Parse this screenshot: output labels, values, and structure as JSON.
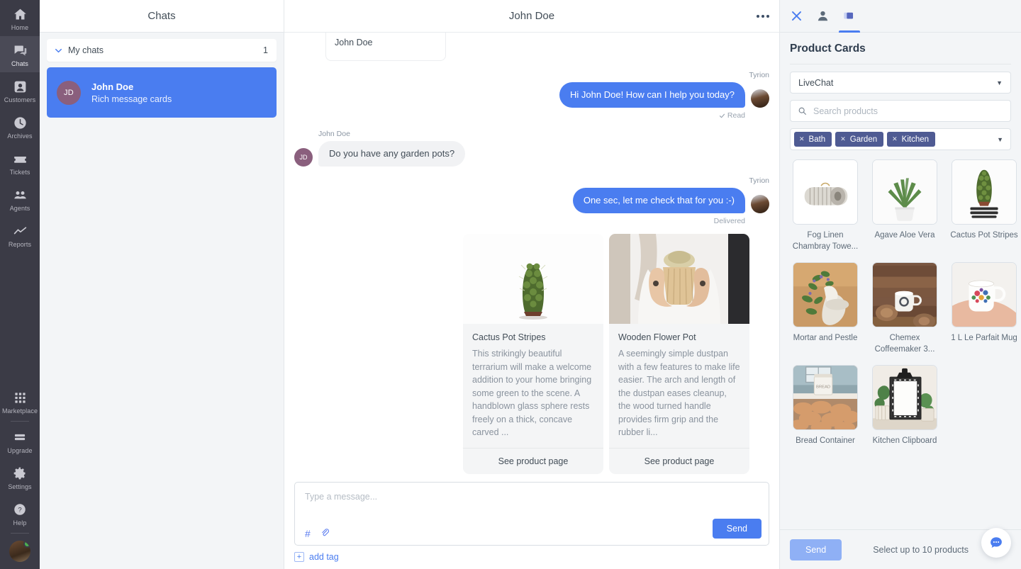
{
  "rail": {
    "items": [
      {
        "label": "Home",
        "icon": "home-icon",
        "active": false
      },
      {
        "label": "Chats",
        "icon": "chats-icon",
        "active": true
      },
      {
        "label": "Customers",
        "icon": "customers-icon",
        "active": false
      },
      {
        "label": "Archives",
        "icon": "archives-icon",
        "active": false
      },
      {
        "label": "Tickets",
        "icon": "tickets-icon",
        "active": false
      },
      {
        "label": "Agents",
        "icon": "agents-icon",
        "active": false
      },
      {
        "label": "Reports",
        "icon": "reports-icon",
        "active": false
      }
    ],
    "bottom_items": [
      {
        "label": "Marketplace",
        "icon": "marketplace-icon"
      },
      {
        "label": "Upgrade",
        "icon": "upgrade-icon"
      },
      {
        "label": "Settings",
        "icon": "gear-icon"
      },
      {
        "label": "Help",
        "icon": "help-icon"
      }
    ]
  },
  "chatlist": {
    "title": "Chats",
    "group": {
      "label": "My chats",
      "count": "1"
    },
    "chats": [
      {
        "initials": "JD",
        "name": "John Doe",
        "preview": "Rich message cards",
        "selected": true
      }
    ]
  },
  "conversation": {
    "title": "John Doe",
    "ghost_card_text": "John Doe",
    "messages": [
      {
        "sender": "Tyrion",
        "side": "out",
        "text": "Hi John Doe! How can I help you today?",
        "status": "Read"
      },
      {
        "sender": "John Doe",
        "side": "in",
        "text": "Do you have any garden pots?",
        "initials": "JD",
        "status": ""
      },
      {
        "sender": "Tyrion",
        "side": "out",
        "text": "One sec, let me check that for you :-)",
        "status": "Delivered"
      }
    ],
    "product_cards": [
      {
        "title": "Cactus Pot Stripes",
        "description": "This strikingly beautiful terrarium will make a welcome addition to your home bringing some green to the scene. A handblown glass sphere rests freely on a thick, concave carved ...",
        "cta": "See product page",
        "image": "cactus-photo"
      },
      {
        "title": "Wooden Flower Pot",
        "description": "A seemingly simple dustpan with a few features to make life easier. The arch and length of the dustpan eases cleanup, the wood turned handle provides firm grip and the rubber li...",
        "cta": "See product page",
        "image": "wooden-flower-pot-photo"
      }
    ],
    "composer": {
      "placeholder": "Type a message...",
      "send_label": "Send",
      "hash_icon": "#",
      "attach_icon": "paperclip-icon",
      "add_tag_label": "add tag",
      "add_tag_plus": "+"
    }
  },
  "right_panel": {
    "tabs": [
      {
        "name": "close-icon",
        "active": false
      },
      {
        "name": "customer-profile-icon",
        "active": false
      },
      {
        "name": "product-cards-icon",
        "active": true
      }
    ],
    "title": "Product Cards",
    "source_select": {
      "value": "LiveChat",
      "caret": "▼"
    },
    "search": {
      "placeholder": "Search products",
      "value": ""
    },
    "filter_chips": [
      {
        "label": "Bath"
      },
      {
        "label": "Garden"
      },
      {
        "label": "Kitchen"
      }
    ],
    "filter_caret": "▼",
    "products": [
      {
        "name": "Fog Linen Chambray Towe...",
        "image": "rolled-towel-photo"
      },
      {
        "name": "Agave Aloe Vera",
        "image": "aloe-plant-photo"
      },
      {
        "name": "Cactus Pot Stripes",
        "image": "cactus-striped-pot-photo"
      },
      {
        "name": "Mortar and Pestle",
        "image": "mortar-pestle-photo"
      },
      {
        "name": "Chemex Coffeemaker 3...",
        "image": "enamel-mug-logs-photo"
      },
      {
        "name": "1 L Le Parfait Mug",
        "image": "floral-mug-photo"
      },
      {
        "name": "Bread Container",
        "image": "bread-container-photo"
      },
      {
        "name": "Kitchen Clipboard",
        "image": "clipboard-photo"
      }
    ],
    "footer": {
      "send_label": "Send",
      "note": "Select up to 10 products"
    },
    "widget_icon": "chat-bubble-icon"
  },
  "colors": {
    "accent": "#4a7df0",
    "chip": "#4f5b93",
    "rail_bg": "#3b3b46",
    "panel_bg": "#f3f5f7",
    "avatar_jd": "#8a5f7d"
  }
}
